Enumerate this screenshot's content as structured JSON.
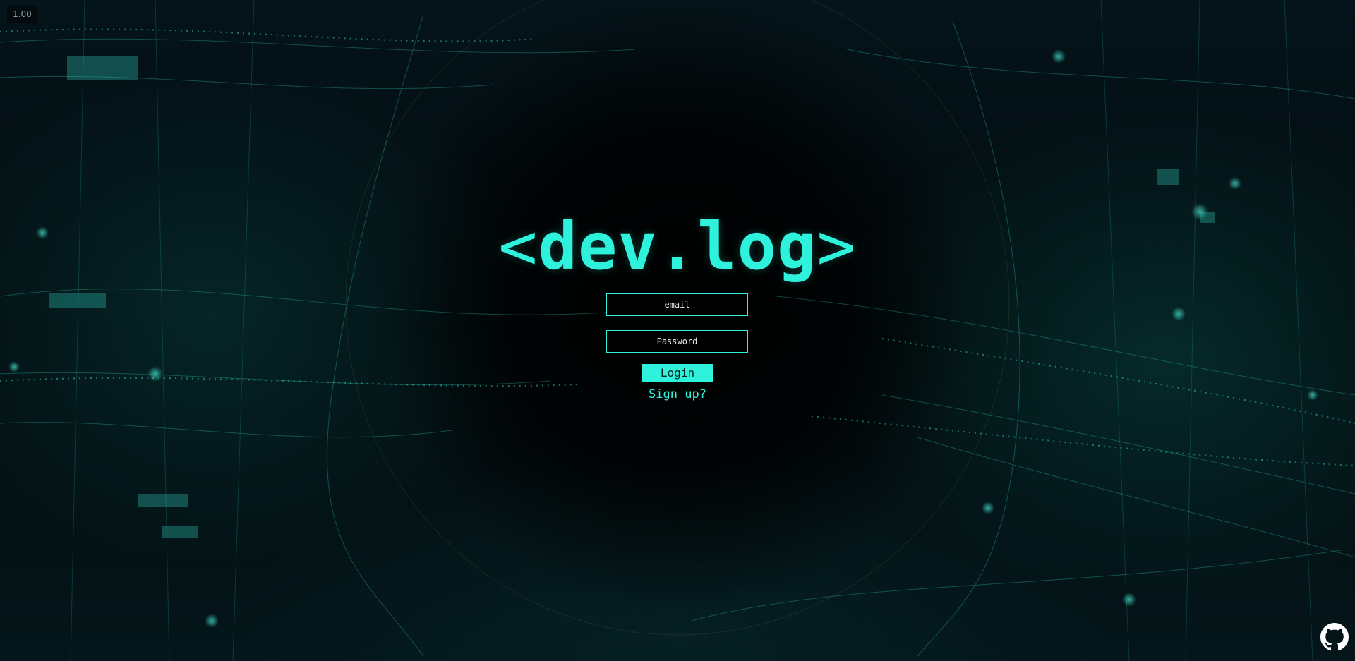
{
  "debug": {
    "fps_readout": "1.00"
  },
  "brand": {
    "bracket_open": "<",
    "name": "dev.log",
    "bracket_close": ">"
  },
  "login_form": {
    "email_placeholder": "email",
    "password_placeholder": "Password",
    "login_label": "Login",
    "signup_label": "Sign up?"
  },
  "footer": {
    "github_icon": "github-icon"
  },
  "colors": {
    "accent": "#2ff2dc",
    "background": "#020608",
    "input_background": "#000000"
  }
}
